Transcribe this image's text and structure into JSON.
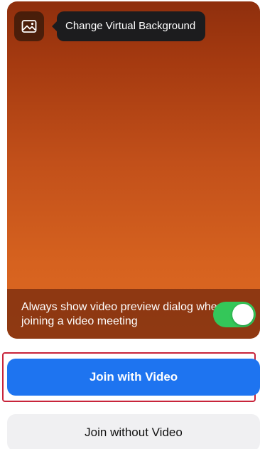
{
  "preview": {
    "change_background_tooltip": "Change Virtual Background",
    "background_icon": "image-icon",
    "preference_label": "Always show video preview dialog when joining a video meeting",
    "toggle_on": true
  },
  "actions": {
    "join_with_video_label": "Join with Video",
    "join_without_video_label": "Join without Video"
  },
  "colors": {
    "primary_blue": "#1e74f0",
    "toggle_green": "#34c759",
    "secondary_gray": "#f0f0f2",
    "highlight_red": "#c8243a"
  }
}
